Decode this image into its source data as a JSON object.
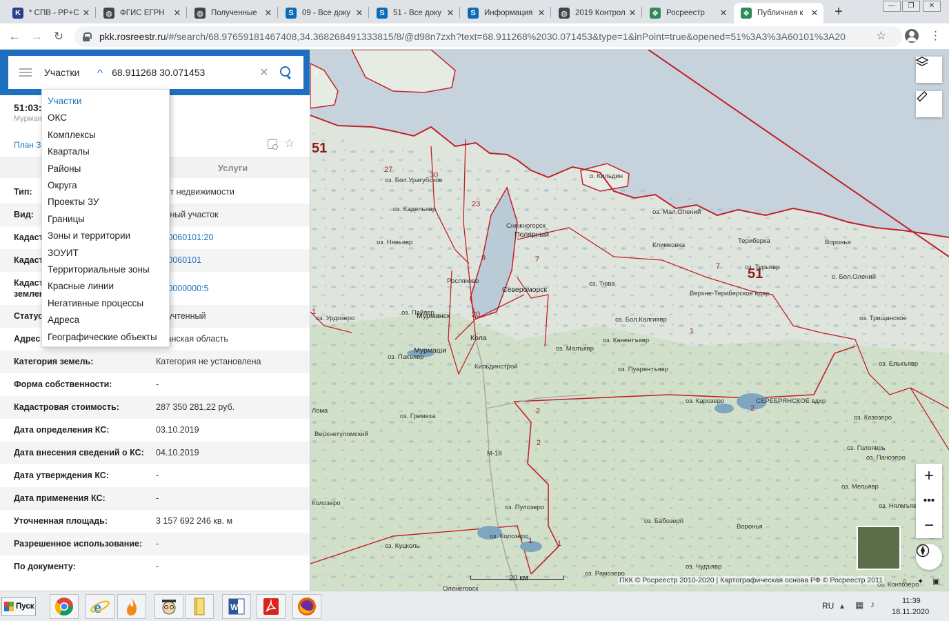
{
  "browser": {
    "tabs": [
      {
        "title": "* СПВ - РР+С",
        "favicon": "k-icon",
        "color": "#2a3f8f"
      },
      {
        "title": "ФГИС ЕГРН",
        "favicon": "globe-icon",
        "color": "#444444"
      },
      {
        "title": "Полученные",
        "favicon": "globe-icon",
        "color": "#444444"
      },
      {
        "title": "09 - Все доку",
        "favicon": "sharepoint-icon",
        "color": "#0b6bb5"
      },
      {
        "title": "51 - Все доку",
        "favicon": "sharepoint-icon",
        "color": "#0b6bb5"
      },
      {
        "title": "Информация",
        "favicon": "sharepoint-icon",
        "color": "#0b6bb5"
      },
      {
        "title": "2019 Контрол",
        "favicon": "globe-icon",
        "color": "#444444"
      },
      {
        "title": "Росреестр",
        "favicon": "rosreestr-icon",
        "color": "#2e8b57"
      },
      {
        "title": "Публичная к",
        "favicon": "rosreestr-icon",
        "color": "#2e8b57"
      }
    ],
    "url_host": "pkk.rosreestr.ru",
    "url_rest": "/#/search/68.97659181467408,34.368268491333815/8/@d98n7zxh?text=68.911268%2030.071453&type=1&inPoint=true&opened=51%3A3%3A60101%3A20"
  },
  "search": {
    "category": "Участки",
    "query": "68.911268 30.071453"
  },
  "dropdown": {
    "items": [
      "Участки",
      "ОКС",
      "Комплексы",
      "Кварталы",
      "Районы",
      "Округа",
      "Проекты ЗУ",
      "Границы",
      "Зоны и территории",
      "ЗОУИТ",
      "Территориальные зоны",
      "Красные линии",
      "Негативные процессы",
      "Адреса",
      "Географические объекты"
    ],
    "selected": "Участки"
  },
  "object": {
    "title_fragment": "51:03:",
    "subtitle_fragment": "Мурман",
    "plan_link": "План З",
    "tab_services": "Услуги"
  },
  "properties": [
    {
      "label": "Тип:",
      "value": "ъект недвижимости",
      "link": false
    },
    {
      "label": "Вид:",
      "value": "ельный участок",
      "link": false
    },
    {
      "label": "Кадаст",
      "value": "03:0060101:20",
      "link": true
    },
    {
      "label": "Кадаст",
      "value": "03:0060101",
      "link": true
    },
    {
      "label": "Кадаст",
      "label2": "землен",
      "value": "00:0000000:5",
      "link": true
    },
    {
      "label": "Статус:",
      "value": "ее учтенный",
      "link": false
    },
    {
      "label": "Адрес:",
      "value": "рманская область",
      "link": false
    },
    {
      "label": "Категория земель:",
      "value": "Категория не установлена",
      "link": false
    },
    {
      "label": "Форма собственности:",
      "value": "-",
      "link": false
    },
    {
      "label": "Кадастровая стоимость:",
      "value": "287 350 281,22 руб.",
      "link": false
    },
    {
      "label": "Дата определения КС:",
      "value": "03.10.2019",
      "link": false
    },
    {
      "label": "Дата внесения сведений о КС:",
      "value": "04.10.2019",
      "link": false
    },
    {
      "label": "Дата утверждения КС:",
      "value": "-",
      "link": false
    },
    {
      "label": "Дата применения КС:",
      "value": "-",
      "link": false
    },
    {
      "label": "Уточненная площадь:",
      "value": "3 157 692 246 кв. м",
      "link": false
    },
    {
      "label": "Разрешенное использование:",
      "value": "-",
      "link": false
    },
    {
      "label": "По документу:",
      "value": "-",
      "link": false
    }
  ],
  "map": {
    "labels": [
      {
        "text": "51",
        "kind": "region"
      },
      {
        "text": "51",
        "kind": "region"
      },
      {
        "text": "27",
        "kind": "district"
      },
      {
        "text": "30",
        "kind": "district"
      },
      {
        "text": "23",
        "kind": "district"
      },
      {
        "text": "9",
        "kind": "district"
      },
      {
        "text": "7",
        "kind": "district"
      },
      {
        "text": "7",
        "kind": "district"
      },
      {
        "text": "20",
        "kind": "district"
      },
      {
        "text": "1",
        "kind": "district"
      },
      {
        "text": "1",
        "kind": "district"
      },
      {
        "text": "2",
        "kind": "district"
      },
      {
        "text": "2",
        "kind": "district"
      },
      {
        "text": "2",
        "kind": "district"
      },
      {
        "text": "1",
        "kind": "district"
      },
      {
        "text": "1",
        "kind": "district"
      },
      {
        "text": "о. Кильдин",
        "kind": "place"
      },
      {
        "text": "оз. Бол.Урагубское",
        "kind": "place"
      },
      {
        "text": "оз. Кадельявр",
        "kind": "place"
      },
      {
        "text": "оз. Нявьявр",
        "kind": "place"
      },
      {
        "text": "Полярный",
        "kind": "city"
      },
      {
        "text": "Снежногорск",
        "kind": "place"
      },
      {
        "text": "Росляково",
        "kind": "place"
      },
      {
        "text": "Североморск",
        "kind": "city"
      },
      {
        "text": "Мурманск",
        "kind": "city"
      },
      {
        "text": "Кола",
        "kind": "city"
      },
      {
        "text": "Мурмаши",
        "kind": "city"
      },
      {
        "text": "Кильдинстрой",
        "kind": "place"
      },
      {
        "text": "оз. Пайявр",
        "kind": "place"
      },
      {
        "text": "оз. Урдозеро",
        "kind": "place"
      },
      {
        "text": "оз. Пакъявр",
        "kind": "place"
      },
      {
        "text": "оз. Тюва",
        "kind": "place"
      },
      {
        "text": "оз. Бол.Калгиявр",
        "kind": "place"
      },
      {
        "text": "оз. Малъявр",
        "kind": "place"
      },
      {
        "text": "оз. Канентъявр",
        "kind": "place"
      },
      {
        "text": "оз. Пуарентъявр",
        "kind": "place"
      },
      {
        "text": "оз. Карозеро",
        "kind": "place"
      },
      {
        "text": "СЕРЕБРЯНСКОЕ вдхр",
        "kind": "place"
      },
      {
        "text": "Верхне-Териберское вдхр",
        "kind": "place"
      },
      {
        "text": "оз. Мал.Олений",
        "kind": "place"
      },
      {
        "text": "Климковка",
        "kind": "place"
      },
      {
        "text": "Териберка",
        "kind": "place"
      },
      {
        "text": "оз. Турьявр",
        "kind": "place"
      },
      {
        "text": "Воронья",
        "kind": "place"
      },
      {
        "text": "о. Бол.Олений",
        "kind": "place"
      },
      {
        "text": "оз. Трищанское",
        "kind": "place"
      },
      {
        "text": "оз. Елькъявр",
        "kind": "place"
      },
      {
        "text": "оз. Гремяха",
        "kind": "place"
      },
      {
        "text": "Верхнетуломский",
        "kind": "place"
      },
      {
        "text": "Ломa",
        "kind": "place"
      },
      {
        "text": "М-18",
        "kind": "place"
      },
      {
        "text": "Колозеро",
        "kind": "place"
      },
      {
        "text": "оз. Пулозеро",
        "kind": "place"
      },
      {
        "text": "оз. Колозеро",
        "kind": "place"
      },
      {
        "text": "оз. Куцколь",
        "kind": "place"
      },
      {
        "text": "оз. Рамозеро",
        "kind": "place"
      },
      {
        "text": "оз. Бабозеро",
        "kind": "place"
      },
      {
        "text": "оз. Чудъявр",
        "kind": "place"
      },
      {
        "text": "Оленегорск",
        "kind": "place"
      },
      {
        "text": "оз. Мельявр",
        "kind": "place"
      },
      {
        "text": "оз. Голояврь",
        "kind": "place"
      },
      {
        "text": "оз. Козозеро",
        "kind": "place"
      },
      {
        "text": "оз. Пачозеро",
        "kind": "place"
      },
      {
        "text": "оз. Нялмъявр",
        "kind": "place"
      },
      {
        "text": "оз. Контозеро",
        "kind": "place"
      },
      {
        "text": "Воронья",
        "kind": "place"
      }
    ],
    "scale": "20 км",
    "copyright": "ПКК © Росреестр 2010-2020 | Картографическая основа РФ © Росреестр 2011"
  },
  "taskbar": {
    "start": "Пуск",
    "apps": [
      "chrome-icon",
      "ie-icon",
      "fire-icon",
      "scholar-icon",
      "folder-icon",
      "word-icon",
      "pdf-icon",
      "firefox-icon"
    ],
    "lang": "RU",
    "time": "11:39",
    "date": "18.11.2020"
  }
}
